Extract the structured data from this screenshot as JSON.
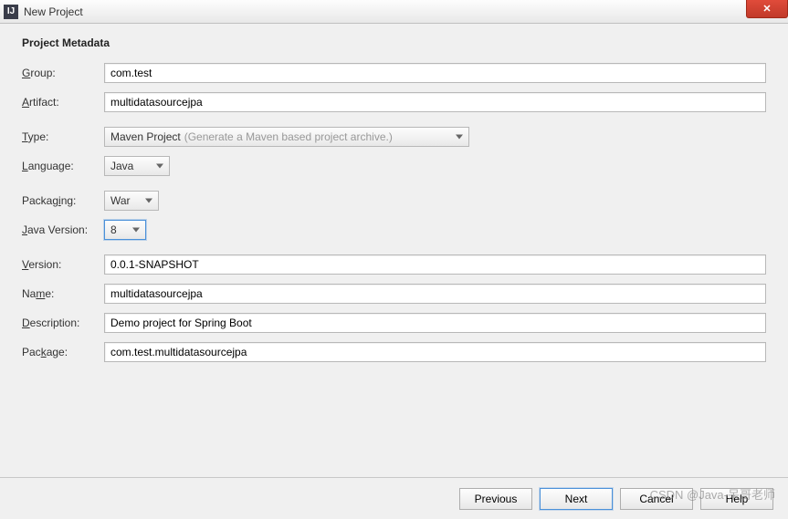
{
  "window": {
    "title": "New Project"
  },
  "heading": "Project Metadata",
  "fields": {
    "group": {
      "label_pre": "",
      "label_ul": "G",
      "label_post": "roup:",
      "value": "com.test"
    },
    "artifact": {
      "label_pre": "",
      "label_ul": "A",
      "label_post": "rtifact:",
      "value": "multidatasourcejpa"
    },
    "type": {
      "label_pre": "",
      "label_ul": "T",
      "label_post": "ype:",
      "value": "Maven Project",
      "hint": "(Generate a Maven based project archive.)"
    },
    "language": {
      "label_pre": "",
      "label_ul": "L",
      "label_post": "anguage:",
      "value": "Java"
    },
    "packaging": {
      "label_pre": "Packag",
      "label_ul": "i",
      "label_post": "ng:",
      "value": "War"
    },
    "javaversion": {
      "label_pre": "",
      "label_ul": "J",
      "label_post": "ava Version:",
      "value": "8"
    },
    "version": {
      "label_pre": "",
      "label_ul": "V",
      "label_post": "ersion:",
      "value": "0.0.1-SNAPSHOT"
    },
    "name": {
      "label_pre": "Na",
      "label_ul": "m",
      "label_post": "e:",
      "value": "multidatasourcejpa"
    },
    "description": {
      "label_pre": "",
      "label_ul": "D",
      "label_post": "escription:",
      "value": "Demo project for Spring Boot"
    },
    "package": {
      "label_pre": "Pac",
      "label_ul": "k",
      "label_post": "age:",
      "value": "com.test.multidatasourcejpa"
    }
  },
  "buttons": {
    "previous": "Previous",
    "next": "Next",
    "cancel": "Cancel",
    "help": "Help"
  },
  "watermark": "CSDN @Java-呆哥老师"
}
